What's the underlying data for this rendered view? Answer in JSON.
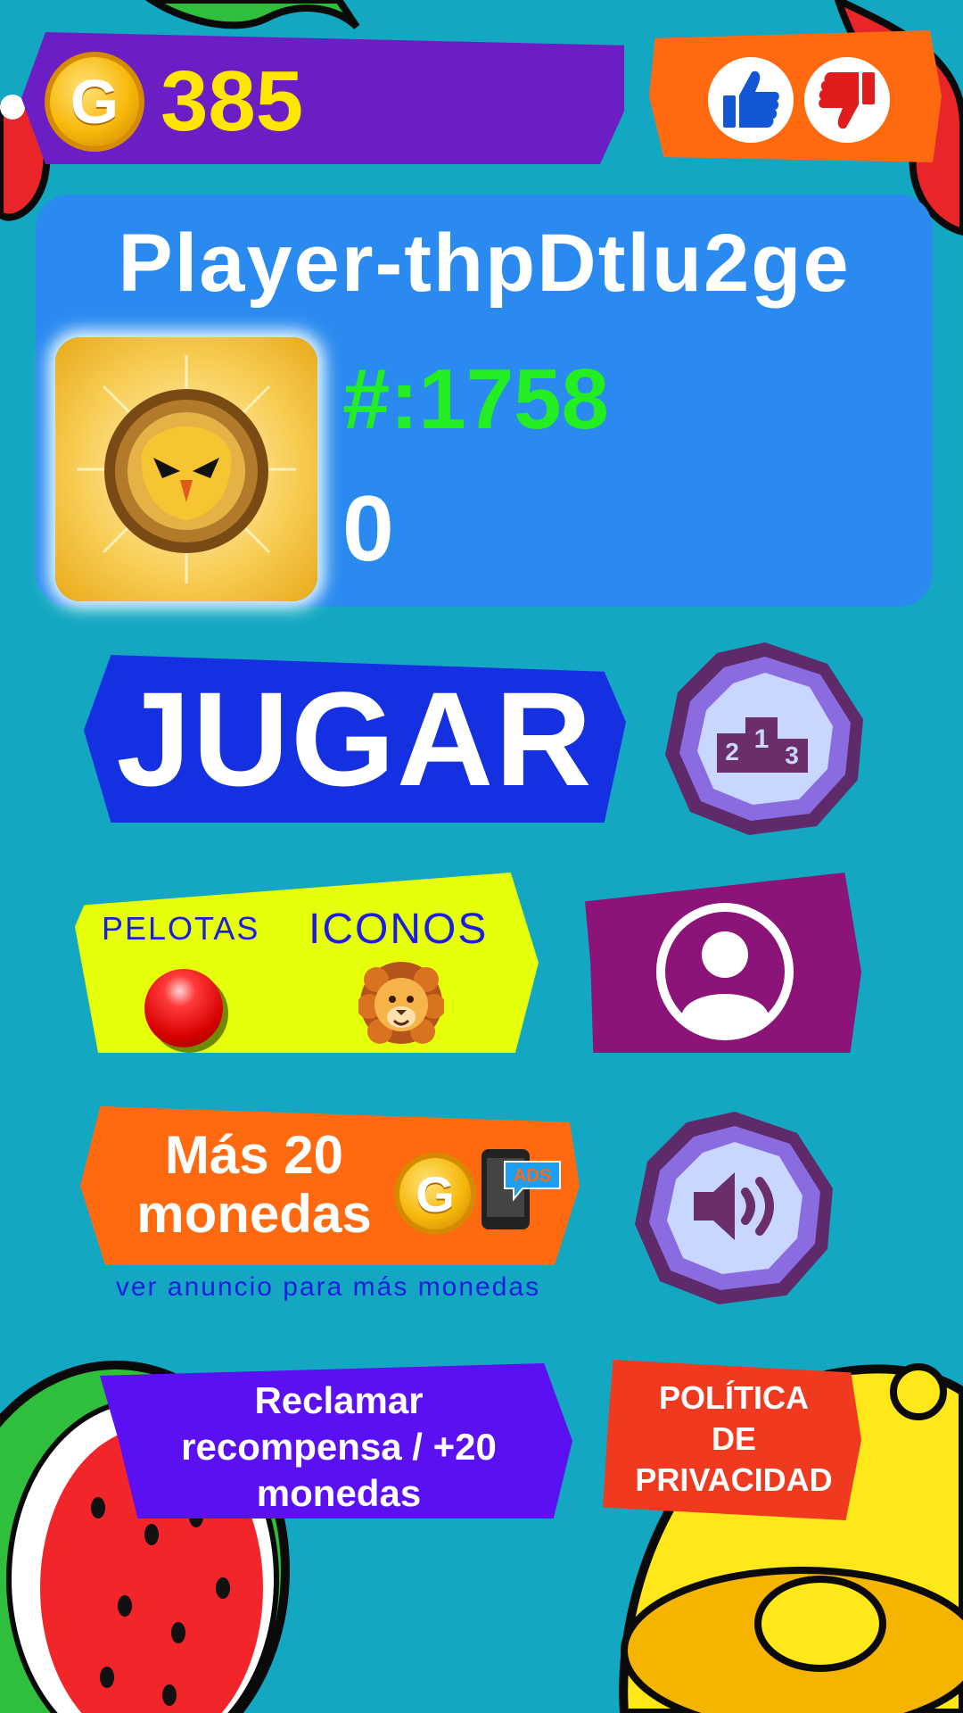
{
  "coins": {
    "count": "385",
    "coin_symbol": "G"
  },
  "rating": {
    "like_icon": "thumbs-up-icon",
    "dislike_icon": "thumbs-down-icon"
  },
  "profile": {
    "player_name": "Player-thpDtlu2ge",
    "rank": "#:1758",
    "score": "0",
    "badge_icon": "golden-eagle-badge-icon"
  },
  "menu": {
    "play_label": "JUGAR",
    "leaderboard_icon": "podium-icon",
    "balls_label": "PELOTAS",
    "icons_label": "ICONOS",
    "profile_icon": "user-avatar-icon",
    "sound_icon": "speaker-icon"
  },
  "ads": {
    "title_line1": "Más 20",
    "title_line2": "monedas",
    "coin_symbol": "G",
    "badge_text": "ADS",
    "hint": "ver anuncio para más monedas"
  },
  "claim": {
    "line1": "Reclamar",
    "line2": "recompensa / +20",
    "line3": "monedas"
  },
  "privacy": {
    "line1": "POLÍTICA",
    "line2": "DE",
    "line3": "PRIVACIDAD"
  },
  "colors": {
    "background": "#14a7c2",
    "coin_bar": "#6a1ec4",
    "rate_bar": "#ff6a10",
    "profile_panel": "#2b8af0",
    "play": "#1430e0",
    "shop": "#e6ff0a",
    "profile_btn": "#8c1478",
    "claim": "#5a10f0",
    "privacy": "#ef3a20",
    "rank_text": "#22ee22",
    "coin_text": "#ffe600"
  }
}
